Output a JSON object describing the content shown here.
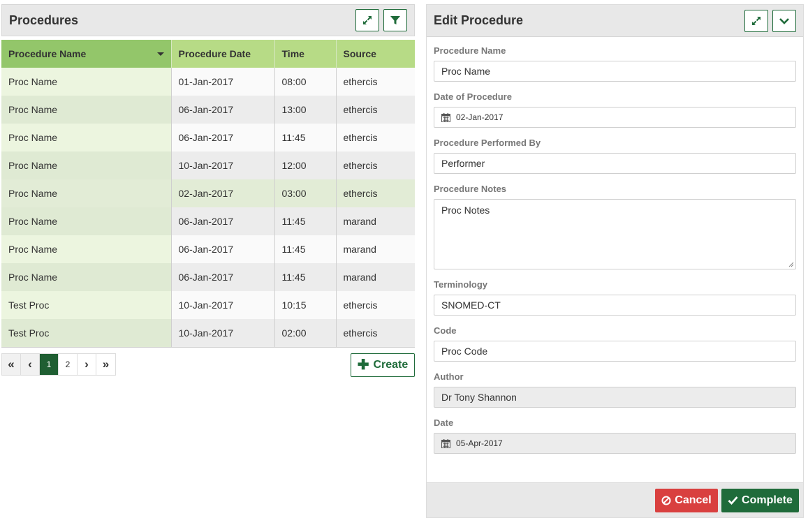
{
  "procedures_panel": {
    "title": "Procedures",
    "expand_icon": "expand-arrows-icon",
    "filter_icon": "filter-icon",
    "columns": [
      "Procedure Name",
      "Procedure Date",
      "Time",
      "Source"
    ],
    "sorted_column": "Procedure Name",
    "rows": [
      [
        "Proc Name",
        "01-Jan-2017",
        "08:00",
        "ethercis"
      ],
      [
        "Proc Name",
        "06-Jan-2017",
        "13:00",
        "ethercis"
      ],
      [
        "Proc Name",
        "06-Jan-2017",
        "11:45",
        "ethercis"
      ],
      [
        "Proc Name",
        "10-Jan-2017",
        "12:00",
        "ethercis"
      ],
      [
        "Proc Name",
        "02-Jan-2017",
        "03:00",
        "ethercis"
      ],
      [
        "Proc Name",
        "06-Jan-2017",
        "11:45",
        "marand"
      ],
      [
        "Proc Name",
        "06-Jan-2017",
        "11:45",
        "marand"
      ],
      [
        "Proc Name",
        "06-Jan-2017",
        "11:45",
        "marand"
      ],
      [
        "Test Proc",
        "10-Jan-2017",
        "10:15",
        "ethercis"
      ],
      [
        "Test Proc",
        "10-Jan-2017",
        "02:00",
        "ethercis"
      ]
    ],
    "selected_row": 5,
    "pagination": {
      "first": "«",
      "prev": "‹",
      "pages": [
        "1",
        "2"
      ],
      "current_page": "1",
      "next": "›",
      "last": "»"
    },
    "create_label": "Create"
  },
  "edit_panel": {
    "title": "Edit Procedure",
    "expand_icon": "expand-arrows-icon",
    "collapse_icon": "chevron-down-icon",
    "fields": {
      "procedure_name": {
        "label": "Procedure Name",
        "value": "Proc Name"
      },
      "date_of_procedure": {
        "label": "Date of Procedure",
        "value": "02-Jan-2017"
      },
      "performed_by": {
        "label": "Procedure Performed By",
        "value": "Performer"
      },
      "notes": {
        "label": "Procedure Notes",
        "value": "Proc Notes"
      },
      "terminology": {
        "label": "Terminology",
        "value": "SNOMED-CT"
      },
      "code": {
        "label": "Code",
        "value": "Proc Code"
      },
      "author": {
        "label": "Author",
        "value": "Dr Tony Shannon"
      },
      "date": {
        "label": "Date",
        "value": "05-Apr-2017"
      }
    },
    "cancel_label": "Cancel",
    "complete_label": "Complete"
  },
  "colors": {
    "primary_green": "#1f6b3a",
    "header_green": "#b7db86",
    "sorted_header_green": "#93c66a",
    "cancel_red": "#d9403f",
    "panel_header_gray": "#e8e8e8"
  }
}
